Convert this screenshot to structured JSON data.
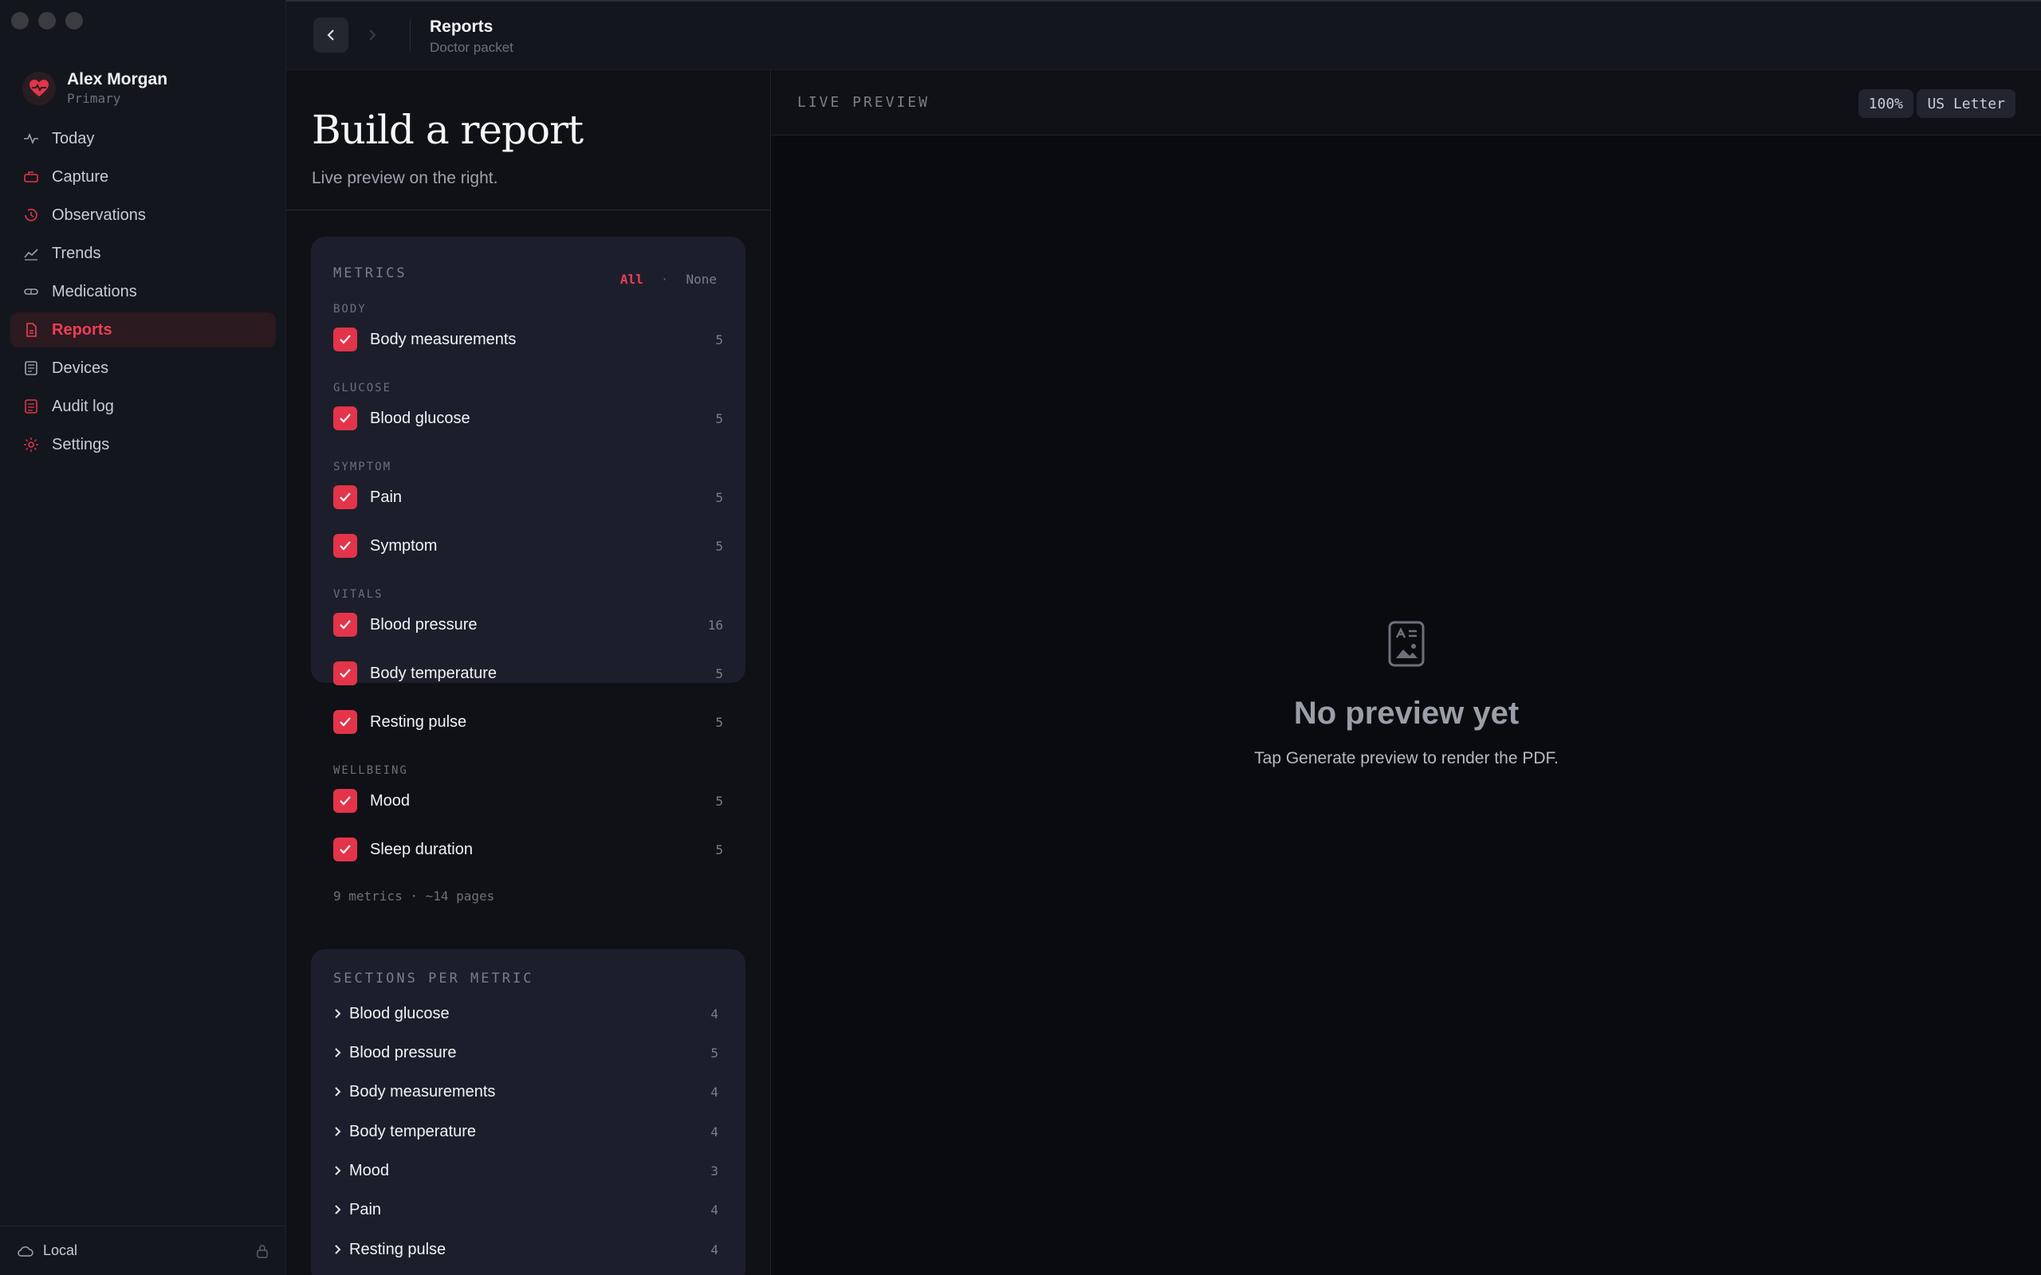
{
  "profile": {
    "name": "Alex Morgan",
    "role": "Primary"
  },
  "nav": [
    {
      "label": "Today",
      "icon": "pulse-icon"
    },
    {
      "label": "Capture",
      "icon": "capture-icon"
    },
    {
      "label": "Observations",
      "icon": "history-icon"
    },
    {
      "label": "Trends",
      "icon": "trend-icon"
    },
    {
      "label": "Medications",
      "icon": "pill-icon"
    },
    {
      "label": "Reports",
      "icon": "report-icon",
      "active": true
    },
    {
      "label": "Devices",
      "icon": "device-icon"
    },
    {
      "label": "Audit log",
      "icon": "audit-icon"
    },
    {
      "label": "Settings",
      "icon": "gear-icon"
    }
  ],
  "footer": {
    "storage": "Local"
  },
  "header": {
    "title": "Reports",
    "subtitle": "Doctor packet"
  },
  "builder": {
    "title": "Build a report",
    "subtitle": "Live preview on the right."
  },
  "metrics": {
    "label": "METRICS",
    "all": "All",
    "separator": "·",
    "none": "None",
    "groups": [
      {
        "label": "BODY",
        "items": [
          {
            "name": "Body measurements",
            "count": "5",
            "checked": true
          }
        ]
      },
      {
        "label": "GLUCOSE",
        "items": [
          {
            "name": "Blood glucose",
            "count": "5",
            "checked": true
          }
        ]
      },
      {
        "label": "SYMPTOM",
        "items": [
          {
            "name": "Pain",
            "count": "5",
            "checked": true
          },
          {
            "name": "Symptom",
            "count": "5",
            "checked": true
          }
        ]
      },
      {
        "label": "VITALS",
        "items": [
          {
            "name": "Blood pressure",
            "count": "16",
            "checked": true
          },
          {
            "name": "Body temperature",
            "count": "5",
            "checked": true
          },
          {
            "name": "Resting pulse",
            "count": "5",
            "checked": true
          }
        ]
      },
      {
        "label": "WELLBEING",
        "items": [
          {
            "name": "Mood",
            "count": "5",
            "checked": true
          },
          {
            "name": "Sleep duration",
            "count": "5",
            "checked": true
          }
        ]
      }
    ],
    "summary": "9 metrics · ~14 pages"
  },
  "sections": {
    "label": "SECTIONS PER METRIC",
    "items": [
      {
        "name": "Blood glucose",
        "count": "4"
      },
      {
        "name": "Blood pressure",
        "count": "5"
      },
      {
        "name": "Body measurements",
        "count": "4"
      },
      {
        "name": "Body temperature",
        "count": "4"
      },
      {
        "name": "Mood",
        "count": "3"
      },
      {
        "name": "Pain",
        "count": "4"
      },
      {
        "name": "Resting pulse",
        "count": "4"
      }
    ]
  },
  "preview": {
    "label": "LIVE PREVIEW",
    "zoom": "100%",
    "paper": "US Letter",
    "empty_title": "No preview yet",
    "empty_subtitle": "Tap Generate preview to render the PDF."
  },
  "colors": {
    "accent": "#e3344a",
    "background": "#0b0c10",
    "panel": "#1c1f2b"
  }
}
